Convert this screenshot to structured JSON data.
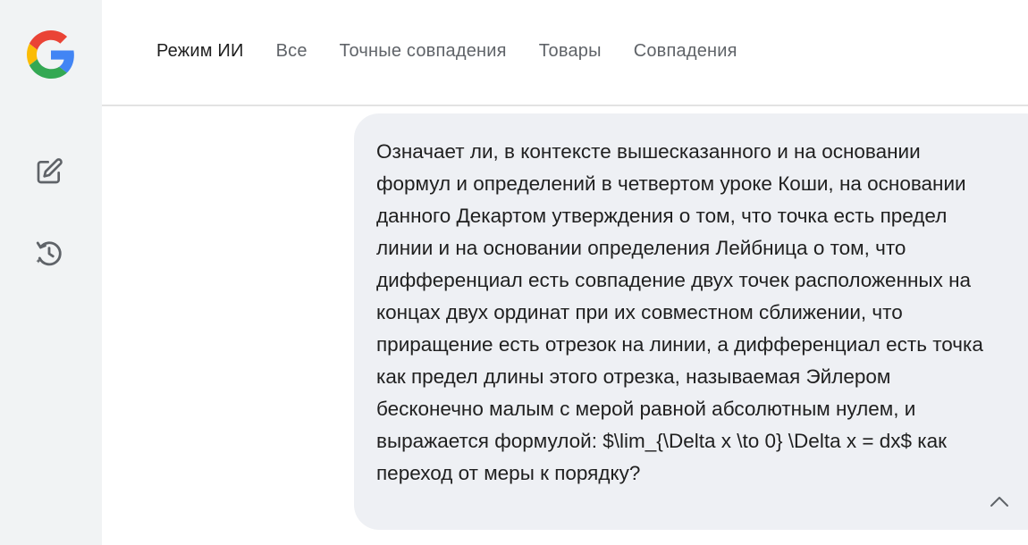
{
  "sidebar": {
    "logo_icon": "google-g-logo",
    "new_chat_icon": "edit-square-icon",
    "history_icon": "history-icon"
  },
  "tabs": [
    {
      "label": "Режим ИИ",
      "active": true
    },
    {
      "label": "Все",
      "active": false
    },
    {
      "label": "Точные совпадения",
      "active": false
    },
    {
      "label": "Товары",
      "active": false
    },
    {
      "label": "Совпадения",
      "active": false
    }
  ],
  "message": {
    "text": "Означает ли, в контексте вышесказанного и на основании формул и определений в четвертом уроке Коши, на основании данного Декартом утверждения о том, что точка есть предел линии и на основании определения Лейбница о том, что дифференциал есть совпадение двух точек расположенных на концах двух ординат при их совместном сближении, что приращение есть отрезок на линии, а дифференциал есть точка как предел длины этого отрезка, называемая Эйлером бесконечно малым с мерой равной абсолютным нулем, и выражается формулой: $\\lim_{\\Delta x \\to 0} \\Delta x = dx$ как переход от меры к порядку?",
    "collapse_icon": "chevron-up-icon"
  },
  "colors": {
    "sidebar_bg": "#f1f3f4",
    "bubble_bg": "#eef0f4",
    "text_primary": "#1f1f1f",
    "text_secondary": "#5f6368"
  }
}
